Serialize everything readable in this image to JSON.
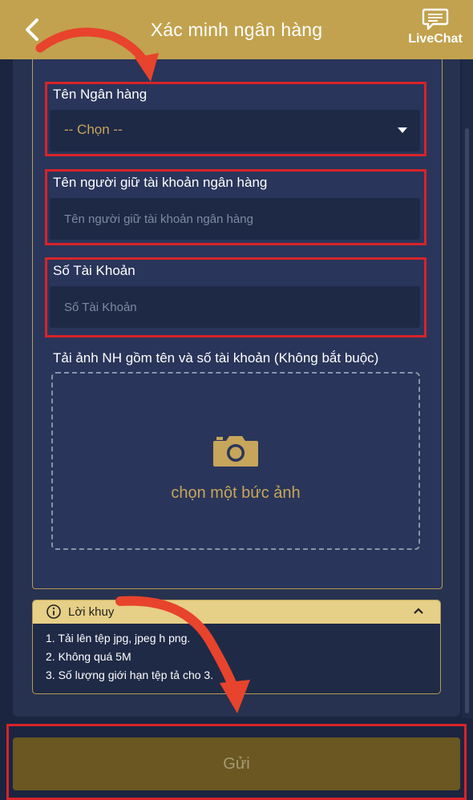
{
  "header": {
    "title": "Xác minh ngân hàng",
    "livechat_label": "LiveChat"
  },
  "form": {
    "bank_name": {
      "label": "Tên Ngân hàng",
      "selected": "-- Chọn --"
    },
    "holder_name": {
      "label": "Tên người giữ tài khoản ngân hàng",
      "value": "",
      "placeholder": "Tên người giữ tài khoản ngân hàng"
    },
    "account_number": {
      "label": "Số Tài Khoản",
      "value": "",
      "placeholder": "Số Tài Khoản"
    },
    "upload": {
      "label": "Tải ảnh NH gồm tên và số tài khoản (Không bắt buộc)",
      "button_text": "chọn một bức ảnh"
    }
  },
  "notice": {
    "title": "Lời khuy",
    "items": [
      "1.  Tải lên tệp jpg, jpeg h     png.",
      "2.  Không quá 5M",
      "3.  Số lượng giới hạn tệp tả       cho 3."
    ]
  },
  "submit": {
    "label": "Gửi"
  },
  "colors": {
    "header_bg": "#c2a24e",
    "page_bg": "#1b2540",
    "accent_gold": "#c7a55a",
    "highlight_red": "#d8232a",
    "arrow_red": "#e8432c",
    "submit_bg": "#6a5722"
  },
  "icons": {
    "back": "chevron-left-icon",
    "livechat": "chat-bubble-icon",
    "dropdown": "caret-down-icon",
    "upload": "camera-icon",
    "info": "info-circle-icon",
    "collapse": "chevron-up-icon"
  }
}
